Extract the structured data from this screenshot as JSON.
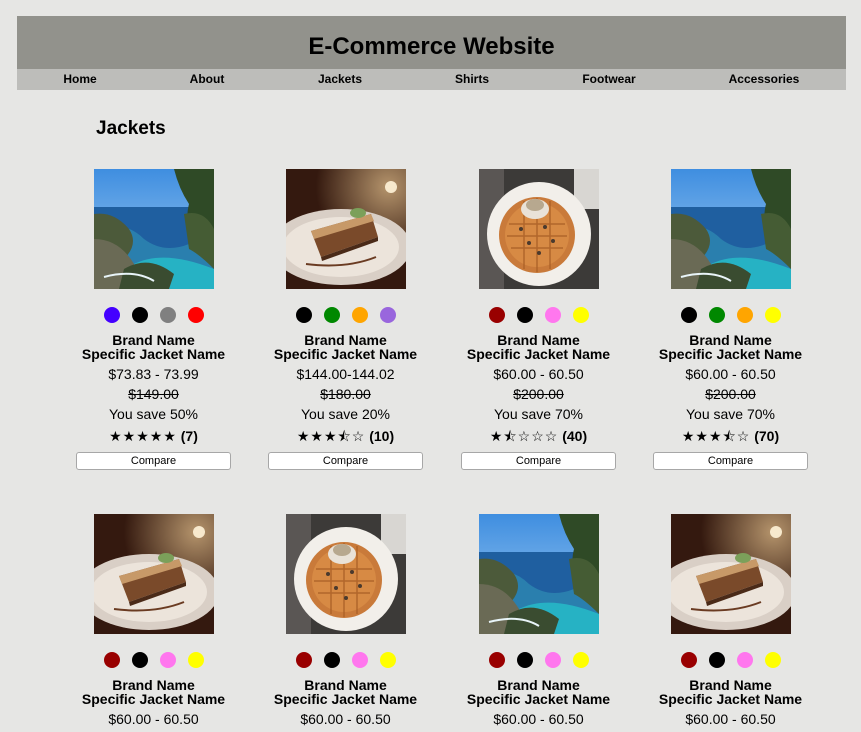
{
  "site": {
    "title": "E-Commerce Website"
  },
  "nav": [
    "Home",
    "About",
    "Jackets",
    "Shirts",
    "Footwear",
    "Accessories"
  ],
  "section": {
    "title": "Jackets"
  },
  "products": [
    {
      "image": "coast",
      "colors": [
        "#4400ff",
        "#000000",
        "#808080",
        "#ff0000"
      ],
      "brand": "Brand Name",
      "name": "Specific Jacket Name",
      "price": "$73.83 - 73.99",
      "original": "$149.00",
      "save": "You save 50%",
      "stars": "★★★★★",
      "count": "(7)",
      "compare": "Compare"
    },
    {
      "image": "cake",
      "colors": [
        "#000000",
        "#008800",
        "#ffa500",
        "#9966dd"
      ],
      "brand": "Brand Name",
      "name": "Specific Jacket Name",
      "price": "$144.00-144.02",
      "original": "$180.00",
      "save": "You save 20%",
      "stars": "★★★⯪☆",
      "count": "(10)",
      "compare": "Compare"
    },
    {
      "image": "waffle",
      "colors": [
        "#990000",
        "#000000",
        "#ff77ee",
        "#ffff00"
      ],
      "brand": "Brand Name",
      "name": "Specific Jacket Name",
      "price": "$60.00 - 60.50",
      "original": "$200.00",
      "save": "You save 70%",
      "stars": "★⯪☆☆☆",
      "count": "(40)",
      "compare": "Compare"
    },
    {
      "image": "coast",
      "colors": [
        "#000000",
        "#008800",
        "#ffa500",
        "#ffff00"
      ],
      "brand": "Brand Name",
      "name": "Specific Jacket Name",
      "price": "$60.00 - 60.50",
      "original": "$200.00",
      "save": "You save 70%",
      "stars": "★★★⯪☆",
      "count": "(70)",
      "compare": "Compare"
    },
    {
      "image": "cake",
      "colors": [
        "#990000",
        "#000000",
        "#ff77ee",
        "#ffff00"
      ],
      "brand": "Brand Name",
      "name": "Specific Jacket Name",
      "price": "$60.00 - 60.50"
    },
    {
      "image": "waffle",
      "colors": [
        "#990000",
        "#000000",
        "#ff77ee",
        "#ffff00"
      ],
      "brand": "Brand Name",
      "name": "Specific Jacket Name",
      "price": "$60.00 - 60.50"
    },
    {
      "image": "coast",
      "colors": [
        "#990000",
        "#000000",
        "#ff77ee",
        "#ffff00"
      ],
      "brand": "Brand Name",
      "name": "Specific Jacket Name",
      "price": "$60.00 - 60.50"
    },
    {
      "image": "cake",
      "colors": [
        "#990000",
        "#000000",
        "#ff77ee",
        "#ffff00"
      ],
      "brand": "Brand Name",
      "name": "Specific Jacket Name",
      "price": "$60.00 - 60.50"
    }
  ]
}
